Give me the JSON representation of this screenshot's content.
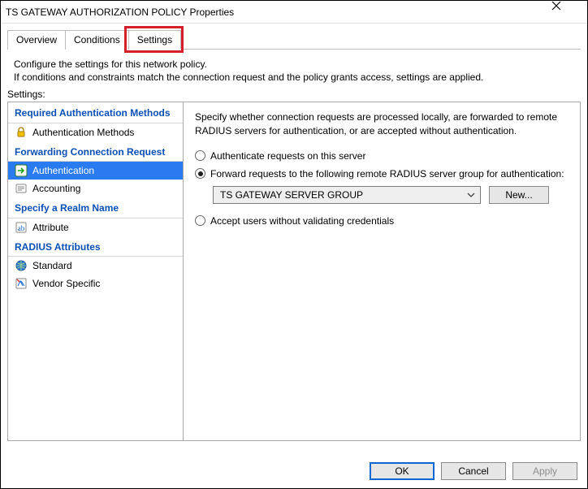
{
  "window": {
    "title": "TS GATEWAY AUTHORIZATION POLICY Properties"
  },
  "tabs": {
    "overview": "Overview",
    "conditions": "Conditions",
    "settings": "Settings"
  },
  "description": {
    "line1": "Configure the settings for this network policy.",
    "line2": "If conditions and constraints match the connection request and the policy grants access, settings are applied."
  },
  "labels": {
    "settings": "Settings:"
  },
  "tree": {
    "groups": [
      {
        "header": "Required Authentication Methods",
        "items": [
          {
            "icon": "lock-icon",
            "label": "Authentication Methods"
          }
        ]
      },
      {
        "header": "Forwarding Connection Request",
        "items": [
          {
            "icon": "arrow-right-icon",
            "label": "Authentication",
            "selected": true
          },
          {
            "icon": "accounting-icon",
            "label": "Accounting"
          }
        ]
      },
      {
        "header": "Specify a Realm Name",
        "items": [
          {
            "icon": "attribute-icon",
            "label": "Attribute"
          }
        ]
      },
      {
        "header": "RADIUS Attributes",
        "items": [
          {
            "icon": "globe-icon",
            "label": "Standard"
          },
          {
            "icon": "vendor-icon",
            "label": "Vendor Specific"
          }
        ]
      }
    ]
  },
  "detail": {
    "description": "Specify whether connection requests are processed locally, are forwarded to remote RADIUS servers for authentication, or are accepted without authentication.",
    "radio_local": "Authenticate requests on this server",
    "radio_forward": "Forward requests to the following remote RADIUS server group for authentication:",
    "radio_accept": "Accept users without validating credentials",
    "combo_value": "TS GATEWAY SERVER GROUP",
    "new_button": "New..."
  },
  "footer": {
    "ok": "OK",
    "cancel": "Cancel",
    "apply": "Apply"
  }
}
